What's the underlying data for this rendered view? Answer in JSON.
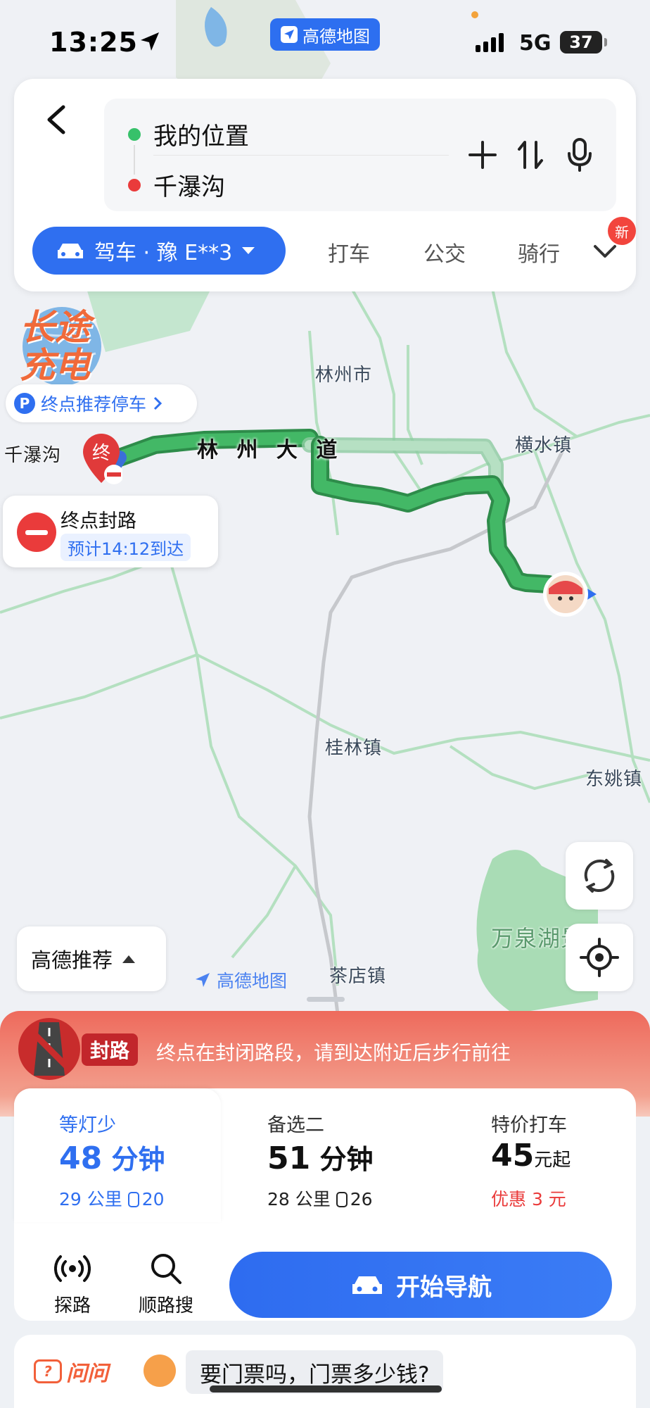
{
  "status": {
    "time": "13:25",
    "network": "5G",
    "battery": "37",
    "app_pill": "高德地图"
  },
  "route": {
    "from": "我的位置",
    "to": "千瀑沟",
    "mode_main": "驾车 · 豫 E**3",
    "modes": [
      "打车",
      "公交",
      "骑行"
    ],
    "new_badge": "新"
  },
  "map": {
    "ev_badge": "长途充电",
    "parking": "终点推荐停车",
    "dest_name": "千瀑沟",
    "dest_pin": "终",
    "block_title": "终点封路",
    "block_eta": "预计14:12到达",
    "road_name": "林 州 大 道",
    "places": {
      "linzhou": "林州市",
      "hengshui": "横水镇",
      "guilin": "桂林镇",
      "dongyao": "东姚镇",
      "wanquanhu": "万泉湖景区",
      "chadian": "茶店镇"
    },
    "recommend": "高德推荐",
    "watermark": "高德地图"
  },
  "alert": {
    "tag": "封路",
    "text": "终点在封闭路段，请到达附近后步行前往"
  },
  "options": [
    {
      "tag": "等灯少",
      "time_num": "48",
      "time_unit": "分钟",
      "dist": "29 公里",
      "lights": "20"
    },
    {
      "tag": "备选二",
      "time_num": "51",
      "time_unit": "分钟",
      "dist": "28 公里",
      "lights": "26"
    },
    {
      "tag": "特价打车",
      "price": "45",
      "price_unit": "元起",
      "discount": "优惠 3 元"
    }
  ],
  "tools": {
    "explore": "探路",
    "along": "顺路搜"
  },
  "nav_label": "开始导航",
  "ask": {
    "logo": "问问",
    "question": "要门票吗，门票多少钱?"
  },
  "colors": {
    "accent": "#2f6ff0",
    "route_green": "#3fb35f",
    "alert_red": "#ea3b3b"
  }
}
